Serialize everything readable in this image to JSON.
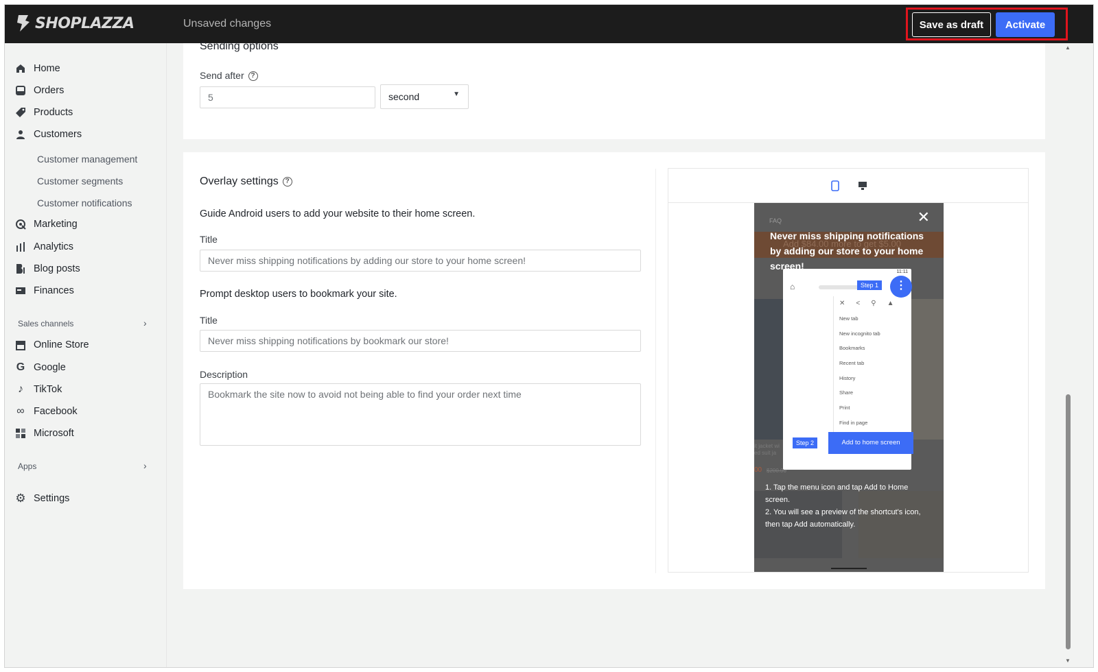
{
  "topbar": {
    "brand": "SHOPLAZZA",
    "status": "Unsaved changes",
    "save_draft_label": "Save as draft",
    "activate_label": "Activate"
  },
  "sidebar": {
    "items": [
      {
        "label": "Home",
        "icon": "home-icon"
      },
      {
        "label": "Orders",
        "icon": "orders-icon"
      },
      {
        "label": "Products",
        "icon": "tag-icon"
      },
      {
        "label": "Customers",
        "icon": "user-icon"
      }
    ],
    "customer_sub": [
      "Customer management",
      "Customer segments",
      "Customer notifications"
    ],
    "items2": [
      {
        "label": "Marketing",
        "icon": "marketing-icon"
      },
      {
        "label": "Analytics",
        "icon": "bar-chart-icon"
      },
      {
        "label": "Blog posts",
        "icon": "blog-icon"
      },
      {
        "label": "Finances",
        "icon": "finance-icon"
      }
    ],
    "sales_channels_label": "Sales channels",
    "channels": [
      {
        "label": "Online Store",
        "icon": "store-icon"
      },
      {
        "label": "Google",
        "icon": "google-icon"
      },
      {
        "label": "TikTok",
        "icon": "tiktok-icon"
      },
      {
        "label": "Facebook",
        "icon": "meta-icon"
      },
      {
        "label": "Microsoft",
        "icon": "microsoft-icon"
      }
    ],
    "apps_label": "Apps",
    "settings_label": "Settings"
  },
  "sending": {
    "heading": "Sending options",
    "send_after_label": "Send after",
    "send_after_value": "5",
    "unit_value": "second"
  },
  "overlay": {
    "heading": "Overlay settings",
    "android_line": "Guide Android users to add your website to their home screen.",
    "title_label_1": "Title",
    "title_value_1": "Never miss shipping notifications by adding our store to your home screen!",
    "desktop_line": "Prompt desktop users to bookmark your site.",
    "title_label_2": "Title",
    "title_value_2": "Never miss shipping notifications by bookmark our store!",
    "description_label": "Description",
    "description_value": "Bookmark the site now to avoid not being able to find your order next time"
  },
  "preview": {
    "faq": "FAQ",
    "bg_promo": "Add $84.00 more to get $5.00",
    "headline": "Never miss shipping notifications by adding our store to your home screen!",
    "status_time": "11:11",
    "step1": "Step 1",
    "step2": "Step 2",
    "menu_items": [
      "New tab",
      "New incognito tab",
      "Bookmarks",
      "Recent tab",
      "History",
      "Share",
      "Print",
      "Find in page"
    ],
    "add_home": "Add to home screen",
    "instructions_1": "1. Tap the menu icon and tap Add to Home screen.",
    "instructions_2": "2. You will see a preview of the shortcut's icon, then tap Add automatically.",
    "bg_item_text": "it jacket wi\ned suit ja",
    "bg_price": "00",
    "bg_old_price": "$200.00"
  },
  "colors": {
    "accent": "#3c6cf6",
    "topbar": "#1c1c1c",
    "annotation": "#e0141d"
  }
}
